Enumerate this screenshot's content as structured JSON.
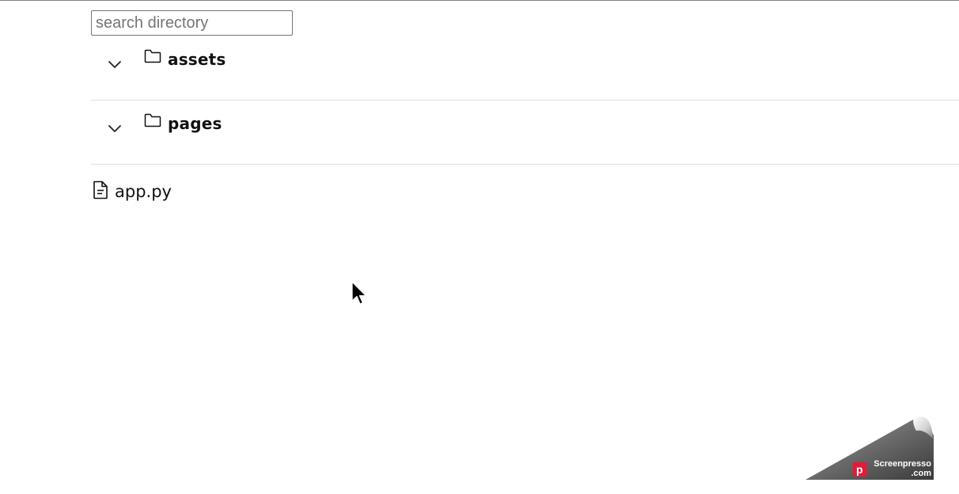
{
  "search": {
    "placeholder": "search directory",
    "value": ""
  },
  "tree": {
    "directories": [
      {
        "name": "assets",
        "icon": "folder-icon",
        "expand_icon": "chevron-down-icon"
      },
      {
        "name": "pages",
        "icon": "folder-icon",
        "expand_icon": "chevron-down-icon"
      }
    ],
    "files": [
      {
        "name": "app.py",
        "icon": "file-text-icon"
      }
    ]
  },
  "watermark": {
    "brand_line1": "Screenpresso",
    "brand_line2": ".com",
    "brand_color": "#e31b3b"
  }
}
